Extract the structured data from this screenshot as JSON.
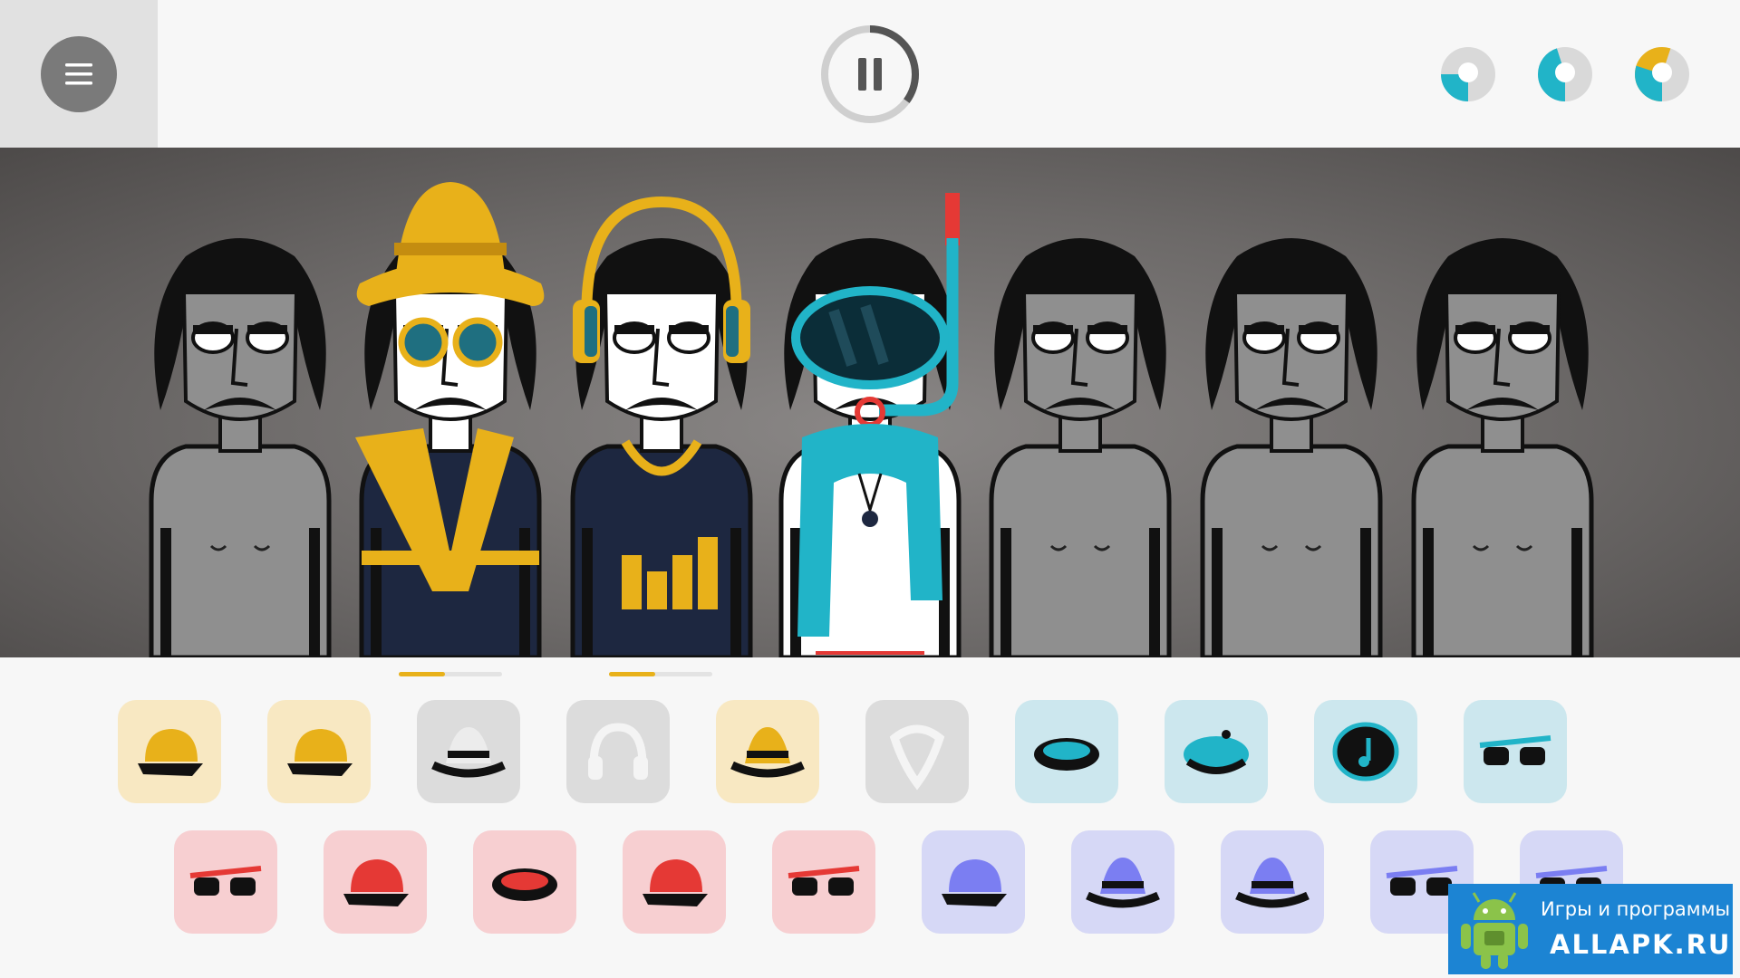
{
  "colors": {
    "yellow": "#e8b11a",
    "teal": "#21b4c8",
    "red": "#e53935",
    "purple": "#7b7ef2",
    "grey_icon": "#d9d9d9"
  },
  "top_bar": {
    "menu_icon": "hamburger-icon",
    "pause_icon": "pause-icon",
    "pause_progress": 0.35,
    "profiles": [
      {
        "icon": "profile-1-icon",
        "fill": 0.25
      },
      {
        "icon": "profile-2-icon",
        "fill": 0.45
      },
      {
        "icon": "profile-3-icon",
        "fill": 0.55
      }
    ]
  },
  "stage": {
    "characters": [
      {
        "name": "plain-1",
        "outfit": "none"
      },
      {
        "name": "yellow-hat",
        "outfit": "hat-glasses-scarf"
      },
      {
        "name": "headphones",
        "outfit": "headphones-equalizer"
      },
      {
        "name": "diver",
        "outfit": "snorkel-mask-scarf"
      },
      {
        "name": "plain-2",
        "outfit": "none"
      },
      {
        "name": "plain-3",
        "outfit": "none"
      },
      {
        "name": "plain-4",
        "outfit": "none"
      }
    ],
    "loop_progress": [
      0.45,
      0.45
    ]
  },
  "tray": {
    "row1": [
      {
        "icon": "yellow-helmet-icon",
        "color": "yellow"
      },
      {
        "icon": "yellow-cap-icon",
        "color": "yellow"
      },
      {
        "icon": "grey-hat-icon",
        "color": "grey"
      },
      {
        "icon": "grey-headphones-icon",
        "color": "grey"
      },
      {
        "icon": "yellow-spiky-hat-icon",
        "color": "yellow"
      },
      {
        "icon": "grey-scarf-icon",
        "color": "grey"
      },
      {
        "icon": "teal-visor-icon",
        "color": "teal"
      },
      {
        "icon": "teal-beret-icon",
        "color": "teal"
      },
      {
        "icon": "teal-music-note-icon",
        "color": "teal"
      },
      {
        "icon": "teal-sunglasses-icon",
        "color": "teal"
      }
    ],
    "row2": [
      {
        "icon": "red-dotted-glasses-icon",
        "color": "red"
      },
      {
        "icon": "red-cap-heart-icon",
        "color": "red"
      },
      {
        "icon": "red-visor-icon",
        "color": "red"
      },
      {
        "icon": "red-cap-icon",
        "color": "red"
      },
      {
        "icon": "red-3d-glasses-icon",
        "color": "red"
      },
      {
        "icon": "purple-cap-icon",
        "color": "purple"
      },
      {
        "icon": "purple-fedora-icon",
        "color": "purple"
      },
      {
        "icon": "purple-hat-icon",
        "color": "purple"
      },
      {
        "icon": "purple-shutter-glasses-icon",
        "color": "purple"
      },
      {
        "icon": "purple-glasses-icon",
        "color": "purple"
      }
    ]
  },
  "watermark": {
    "line1": "Игры и программы",
    "line2": "ALLAPK.RU",
    "icon": "android-robot-icon"
  }
}
